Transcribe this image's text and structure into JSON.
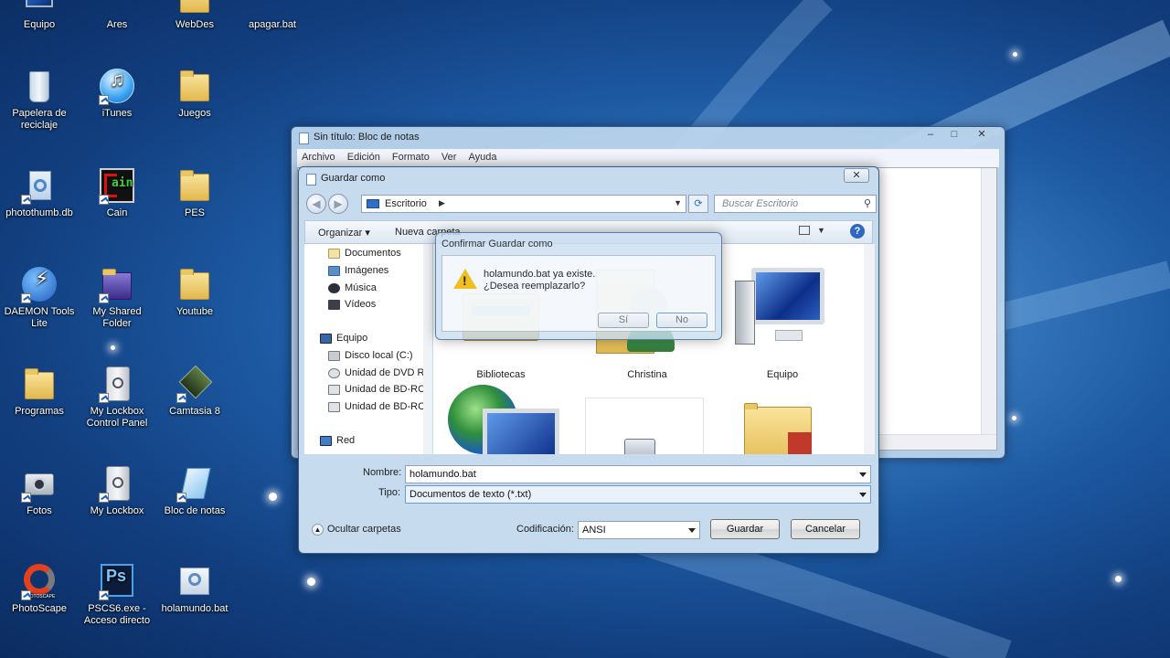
{
  "desktop": {
    "icons": [
      {
        "label": "Equipo"
      },
      {
        "label": "Ares"
      },
      {
        "label": "WebDes"
      },
      {
        "label": "apagar.bat"
      },
      {
        "label": "Papelera de reciclaje"
      },
      {
        "label": "iTunes"
      },
      {
        "label": "Juegos"
      },
      {
        "label": "photothumb.db"
      },
      {
        "label": "Cain"
      },
      {
        "label": "PES"
      },
      {
        "label": "DAEMON Tools Lite"
      },
      {
        "label": "My Shared Folder"
      },
      {
        "label": "Youtube"
      },
      {
        "label": "Programas"
      },
      {
        "label": "My Lockbox Control Panel"
      },
      {
        "label": "Camtasia 8"
      },
      {
        "label": "Fotos"
      },
      {
        "label": "My Lockbox"
      },
      {
        "label": "Bloc de notas"
      },
      {
        "label": "PhotoScape"
      },
      {
        "label": "PSCS6.exe - Acceso directo"
      },
      {
        "label": "holamundo.bat"
      }
    ],
    "cain_logo_text": "ain",
    "photoshop_logo_text": "Ps",
    "photoscape_small_text": "PHOTOSCAPE"
  },
  "notepad": {
    "title": "Sin título: Bloc de notas",
    "menu": [
      "Archivo",
      "Edición",
      "Formato",
      "Ver",
      "Ayuda"
    ]
  },
  "save_dialog": {
    "title": "Guardar como",
    "address": "Escritorio",
    "search_placeholder": "Buscar Escritorio",
    "organize_label": "Organizar",
    "new_folder_label": "Nueva carpeta",
    "nav_items": [
      {
        "label": "Documentos"
      },
      {
        "label": "Imágenes"
      },
      {
        "label": "Música"
      },
      {
        "label": "Vídeos"
      },
      {
        "label": "Equipo"
      },
      {
        "label": "Disco local (C:)"
      },
      {
        "label": "Unidad de DVD R"
      },
      {
        "label": "Unidad de BD-RC"
      },
      {
        "label": "Unidad de BD-RC"
      },
      {
        "label": "Red"
      }
    ],
    "items": [
      {
        "label": "Bibliotecas"
      },
      {
        "label": "Christina"
      },
      {
        "label": "Equipo"
      }
    ],
    "filename_label": "Nombre:",
    "filename_value": "holamundo.bat",
    "type_label": "Tipo:",
    "type_value": "Documentos de texto (*.txt)",
    "hide_folders_label": "Ocultar carpetas",
    "encoding_label": "Codificación:",
    "encoding_value": "ANSI",
    "save_label": "Guardar",
    "cancel_label": "Cancelar"
  },
  "confirm_dialog": {
    "title": "Confirmar Guardar como",
    "line1": "holamundo.bat ya existe.",
    "line2": "¿Desea reemplazarlo?",
    "yes_label": "Sí",
    "no_label": "No"
  }
}
